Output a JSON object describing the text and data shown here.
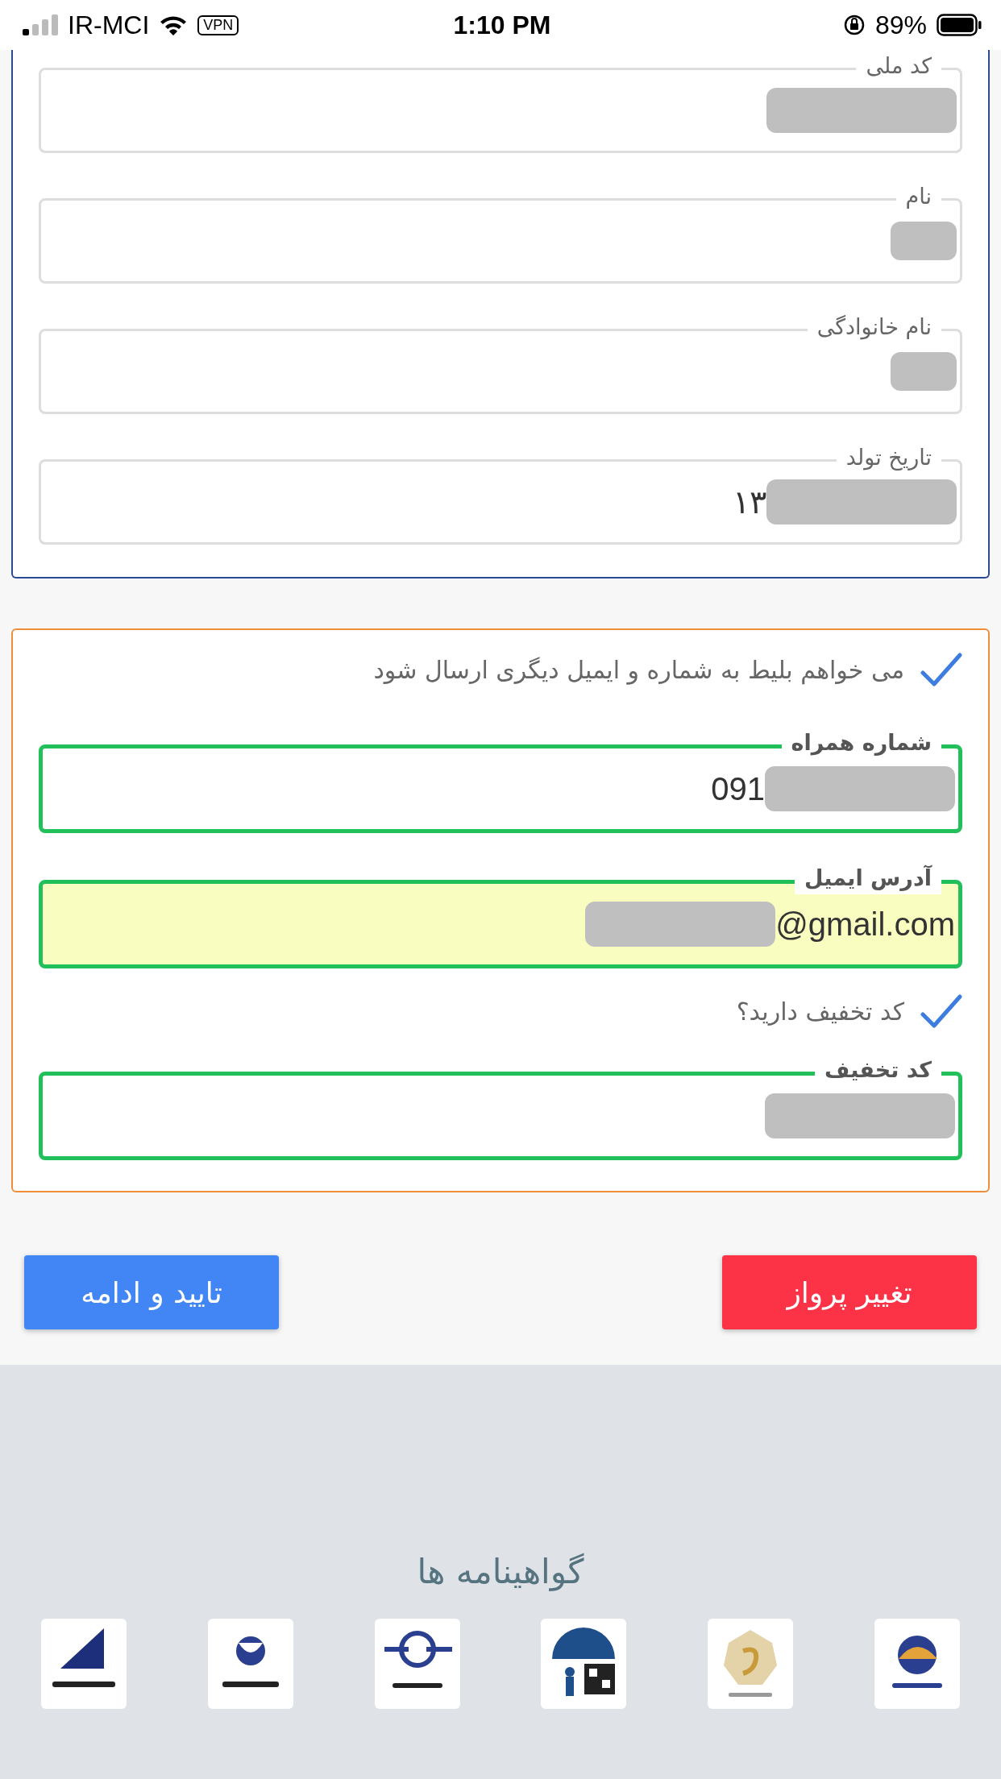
{
  "status_bar": {
    "carrier": "IR-MCI",
    "vpn": "VPN",
    "time": "1:10 PM",
    "battery": "89%"
  },
  "personal_fields": [
    {
      "label": "کد ملی",
      "redacted": true,
      "highlighted": false,
      "valid": false
    },
    {
      "label": "نام",
      "redacted": true,
      "highlighted": false,
      "valid": false
    },
    {
      "label": "نام خانوادگی",
      "redacted": true,
      "highlighted": false,
      "valid": false
    },
    {
      "label": "تاریخ تولد",
      "prefix": "۱۳",
      "redacted": true,
      "highlighted": false,
      "valid": false
    }
  ],
  "contact": {
    "send_other": {
      "label": "می خواهم بلیط به شماره و ایمیل دیگری ارسال شود",
      "checked": true
    },
    "fields": [
      {
        "label": "شماره همراه",
        "prefix": "091",
        "redacted": true,
        "highlighted": false,
        "valid": true
      },
      {
        "label": "آدرس ایمیل",
        "suffix": "@gmail.com",
        "redacted": true,
        "highlighted": true,
        "valid": true
      }
    ],
    "discount_toggle": {
      "label": "کد تخفیف دارید؟",
      "checked": true
    },
    "discount_field": {
      "label": "کد تخفیف",
      "redacted": true,
      "highlighted": false,
      "valid": true
    }
  },
  "buttons": [
    {
      "label": "تغییر پرواز",
      "kind": "danger"
    },
    {
      "label": "تایید و ادامه",
      "kind": "primary"
    }
  ],
  "footer": {
    "title": "گواهینامه ها"
  }
}
